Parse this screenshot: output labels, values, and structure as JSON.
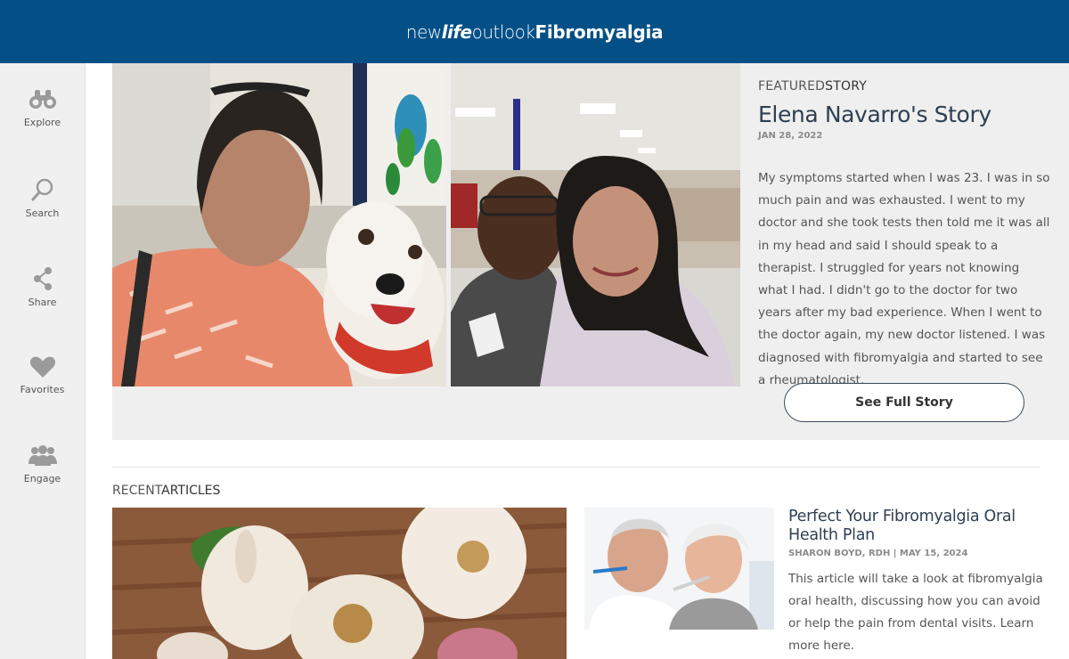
{
  "header": {
    "logo_part1": "new",
    "logo_part2": "life",
    "logo_part3": "outlook",
    "logo_part4": "Fibromyalgia"
  },
  "sidebar": {
    "items": [
      {
        "label": "Explore",
        "icon": "binoculars-icon"
      },
      {
        "label": "Search",
        "icon": "search-icon"
      },
      {
        "label": "Share",
        "icon": "share-icon"
      },
      {
        "label": "Favorites",
        "icon": "heart-icon"
      },
      {
        "label": "Engage",
        "icon": "group-icon"
      }
    ]
  },
  "featured": {
    "kicker_light": "FEATURED",
    "kicker_bold": "STORY",
    "title": "Elena Navarro's Story",
    "date": "JAN 28, 2022",
    "body": "My symptoms started when I was 23. I was in so much pain and was exhausted. I went to my doctor and she took tests then told me it was all in my head and said I should speak to a therapist. I struggled for years not knowing what I had. I didn't go to the doctor for two years after my bad experience. When I went to the doctor again, my new doctor listened. I was diagnosed with fibromyalgia and started to see a rheumatologist.",
    "button_label": "See Full Story"
  },
  "recent": {
    "heading_light": "RECENT",
    "heading_bold": "ARTICLES",
    "article": {
      "title": "Perfect Your Fibromyalgia Oral Health Plan",
      "meta": "SHARON BOYD, RDH | MAY 15, 2024",
      "body": "This article will take a look at fibromyalgia oral health, discussing how you can avoid or help the pain from dental visits. Learn more here."
    }
  },
  "colors": {
    "header_bg": "#045086",
    "sidebar_bg": "#f0f0f0",
    "featured_bg": "#efefef",
    "title_color": "#2f3f52"
  }
}
